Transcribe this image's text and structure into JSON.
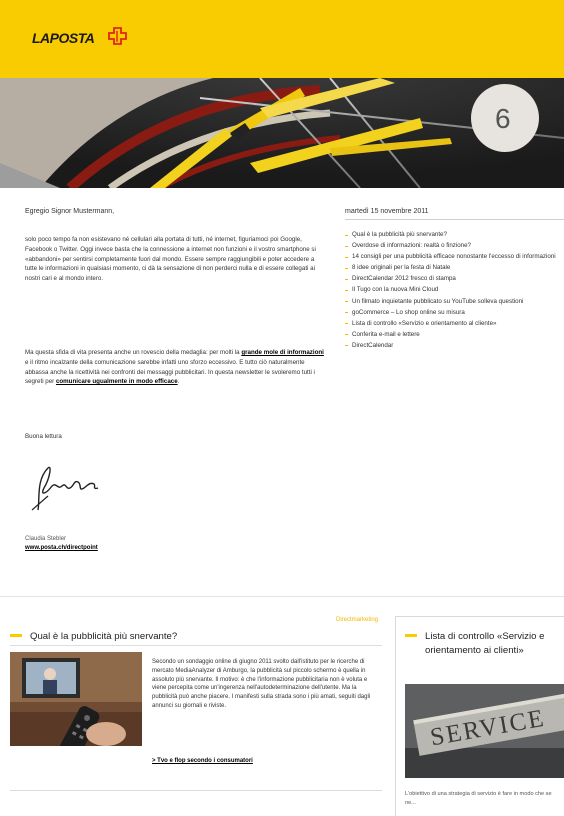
{
  "brand": {
    "logo_text": "LAPOSTA",
    "color_yellow": "#f8cc00"
  },
  "letter": {
    "greeting": "Egregio Signor Mustermann,",
    "intro": "solo poco tempo fa non esistevano né cellulari alla portata di tutti, né internet, figuriamoci poi Google, Facebook o Twitter. Oggi invece basta che la connessione a internet non funzioni e il vostro smartphone si «abbandoni» per sentirsi completamente fuori dal mondo. Essere sempre raggiungibili e poter accedere a tutte le informazioni in qualsiasi momento, ci dà la sensazione di non perderci nulla e di essere collegati ai nostri cari e al mondo intero.",
    "para2_before": "Ma questa sfida di vita presenta anche un rovescio della medaglia: per molti la ",
    "para2_bold": "grande mole di informazioni",
    "para2_mid": " e il ritmo incalzante della comunicazione sarebbe infatti uno sforzo eccessivo. E tutto ciò naturalmente abbassa anche la ricettività nei confronti dei messaggi pubblicitari. In questa newsletter le svoleremo tutti i segreti per ",
    "para2_link": "comunicare ugualmente in modo efficace",
    "para2_end": ".",
    "closing": "Buona lettura",
    "signer_name": "Claudia Stebler",
    "signer_url": "www.posta.ch/directpoint"
  },
  "sidebar": {
    "date": "martedì 15 novembre 2011",
    "toc": [
      "Qual è la pubblicità più snervante?",
      "Overdose di informazioni: realtà o finzione?",
      "14 consigli per una pubblicità efficace nonostante l'eccesso di informazioni",
      "8 idee originali per la festa di Natale",
      "DirectCalendar 2012 fresco di stampa",
      "Il Tugo con la nuova Mini Cloud",
      "Un filmato inquietante pubblicato su YouTube solleva questioni",
      "goCommerce – Lo shop online su misura",
      "Lista di controllo «Servizio e orientamento al cliente»",
      "Conferita e-mail e lettere",
      "DirectCalendar"
    ]
  },
  "article": {
    "category": "Directmarketing",
    "title": "Qual è la pubblicità più snervante?",
    "body": "Secondo un sondaggio online di giugno 2011 svolto dall'istituto per le ricerche di mercato MediaAnalyzer di Amburgo, la pubblicità sul piccolo schermo è quella in assoluto più snervante. Il motivo: è che l'informazione pubblicitaria non è voluta e viene percepita come un'ingerenza nell'autodeterminazione dell'utente. Ma la pubblicità può anche piacere. I manifesti sulla strada sono i più amati, seguiti dagli annunci su giornali e riviste.",
    "link": "> Tvo e flop secondo i consumatori"
  },
  "sidebox": {
    "title": "Lista di controllo «Servizio e orientamento ai clienti»",
    "image_sign": "SERVICE",
    "body": "L'obiettivo di una strategia di servizio è fare in modo che se ne..."
  }
}
